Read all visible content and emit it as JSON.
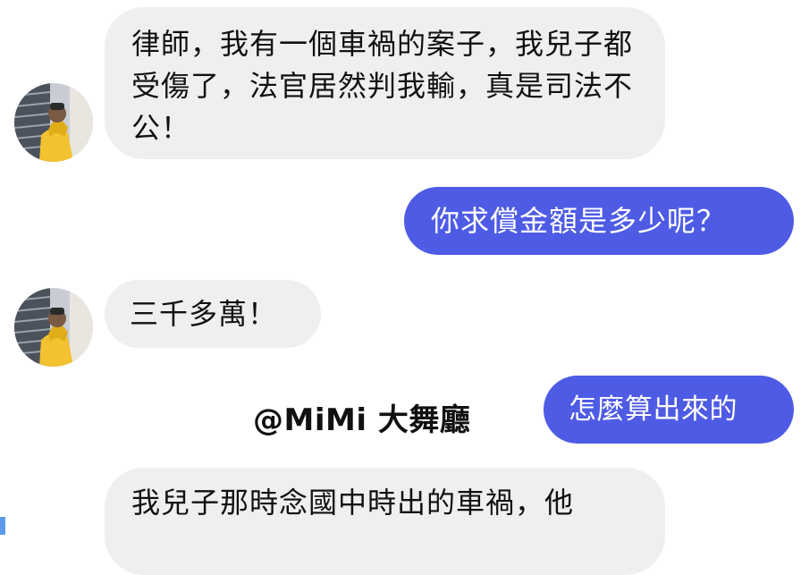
{
  "messages": [
    {
      "side": "incoming",
      "text": "律師，我有一個車禍的案子，我兒子都受傷了，法官居然判我輸，真是司法不公！"
    },
    {
      "side": "outgoing",
      "text": "你求償金額是多少呢？"
    },
    {
      "side": "incoming",
      "text": "三千多萬！"
    },
    {
      "side": "outgoing",
      "text": "怎麼算出來的"
    },
    {
      "side": "incoming",
      "text": "我兒子那時念國中時出的車禍，他"
    }
  ],
  "watermark": "@MiMi 大舞廳",
  "colors": {
    "incoming_bubble": "#efefef",
    "outgoing_bubble": "#4e5be4",
    "outgoing_text": "#ffffff"
  },
  "icons": {
    "avatar": "avatar-person-yellow-hoodie"
  }
}
